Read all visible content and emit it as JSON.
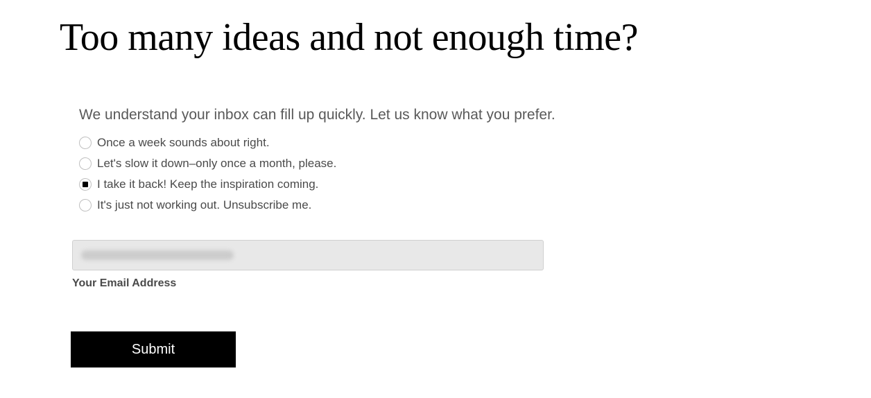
{
  "title": "Too many ideas and not enough time?",
  "prompt": "We understand your inbox can fill up quickly. Let us know what you prefer.",
  "options": [
    {
      "label": "Once a week sounds about right.",
      "selected": false
    },
    {
      "label": "Let's slow it down–only once a month, please.",
      "selected": false
    },
    {
      "label": "I take it back! Keep the inspiration coming.",
      "selected": true
    },
    {
      "label": "It's just not working out. Unsubscribe me.",
      "selected": false
    }
  ],
  "email": {
    "label": "Your Email Address",
    "value": ""
  },
  "submit_label": "Submit"
}
